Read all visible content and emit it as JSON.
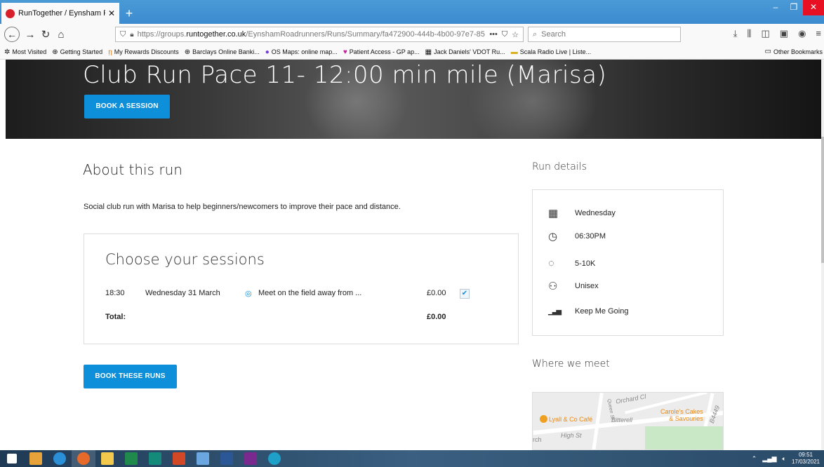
{
  "browser": {
    "tab_title": "RunTogether / Eynsham Roadr",
    "tab_close": "✕",
    "new_tab": "+",
    "window_controls": {
      "minimize": "–",
      "restore": "❐",
      "close": "✕"
    },
    "url_prefix": "https://groups.",
    "url_domain": "runtogether.co.uk",
    "url_path": "/EynshamRoadrunners/Runs/Summary/fa472900-444b-4b00-97e7-85",
    "search_placeholder": "Search",
    "icons": [
      "back-icon",
      "forward-icon",
      "reload-icon",
      "home-icon",
      "shield-icon",
      "lock-icon",
      "more-icon",
      "pocket-icon",
      "star-icon",
      "download-icon",
      "library-icon",
      "sidebar-icon",
      "screenshot-icon",
      "account-icon",
      "menu-icon"
    ]
  },
  "bookmarks": {
    "items": [
      {
        "icon": "✲",
        "label": "Most Visited"
      },
      {
        "icon": "⊕",
        "label": "Getting Started"
      },
      {
        "icon": "ῃ",
        "label": "My Rewards Discounts"
      },
      {
        "icon": "⊕",
        "label": "Barclays Online Banki..."
      },
      {
        "icon": "●",
        "label": "OS Maps: online map..."
      },
      {
        "icon": "♥",
        "label": "Patient Access - GP ap..."
      },
      {
        "icon": "▦",
        "label": "Jack Daniels' VDOT Ru..."
      },
      {
        "icon": "▬",
        "label": "Scala Radio Live | Liste..."
      }
    ],
    "other": "Other Bookmarks"
  },
  "hero": {
    "title": "Club Run Pace 11- 12:00 min mile (Marisa)",
    "button": "BOOK A SESSION"
  },
  "about": {
    "title": "About this run",
    "description": "Social club run with Marisa to help beginners/newcomers to improve their pace and distance."
  },
  "sessions": {
    "title": "Choose your sessions",
    "row": {
      "time": "18:30",
      "date": "Wednesday 31 March",
      "location": "Meet on the field away from ...",
      "price": "£0.00",
      "checked": "✔"
    },
    "total_label": "Total:",
    "total_value": "£0.00",
    "book_button": "BOOK THESE RUNS"
  },
  "run_details": {
    "title": "Run details",
    "items": [
      {
        "icon": "calendar-icon",
        "glyph": "▦",
        "label": "Wednesday"
      },
      {
        "icon": "clock-icon",
        "glyph": "◷",
        "label": "06:30PM"
      },
      {
        "icon": "stopwatch-icon",
        "glyph": "◌",
        "label": "5-10K"
      },
      {
        "icon": "people-icon",
        "glyph": "⚇",
        "label": "Unisex"
      },
      {
        "icon": "signal-bars-icon",
        "glyph": "▁▃▅",
        "label": "Keep Me Going"
      }
    ]
  },
  "where_we_meet": {
    "title": "Where we meet",
    "map_labels": {
      "orchard": "Orchard Cl",
      "lyall": "Lyall & Co Café",
      "bitterell": "Bitterell",
      "carole1": "Carole's Cakes",
      "carole2": "& Savouries",
      "high_st": "High St",
      "queen_st": "Queen St",
      "b4449": "B4449",
      "church": "rch"
    }
  },
  "taskbar": {
    "time": "09:51",
    "date": "17/03/2021",
    "apps": [
      {
        "name": "start",
        "color": "#ffffff"
      },
      {
        "name": "outlook",
        "color": "#e8a23a"
      },
      {
        "name": "ie",
        "color": "#2b8fd8"
      },
      {
        "name": "firefox",
        "color": "#e86a2a"
      },
      {
        "name": "explorer",
        "color": "#f2c94c"
      },
      {
        "name": "excel",
        "color": "#1f8a4c"
      },
      {
        "name": "publisher",
        "color": "#148a7a"
      },
      {
        "name": "powerpoint",
        "color": "#d24726"
      },
      {
        "name": "app-blue",
        "color": "#6aa7e0"
      },
      {
        "name": "word",
        "color": "#2b5797"
      },
      {
        "name": "onenote",
        "color": "#7a2a8f"
      },
      {
        "name": "edge",
        "color": "#1ea0c8"
      }
    ]
  },
  "colors": {
    "accent": "#0e8fd9",
    "tabbar": "#3c8bd0"
  }
}
